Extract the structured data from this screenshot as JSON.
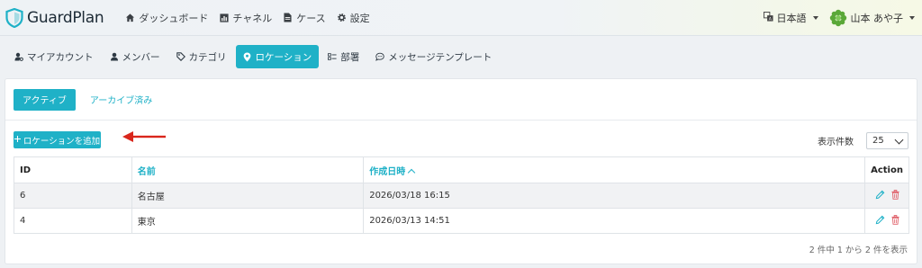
{
  "brand": {
    "name": "GuardPlan"
  },
  "topnav": [
    {
      "label": "ダッシュボード",
      "icon": "home-icon"
    },
    {
      "label": "チャネル",
      "icon": "chart-icon"
    },
    {
      "label": "ケース",
      "icon": "document-icon"
    },
    {
      "label": "設定",
      "icon": "gear-icon"
    }
  ],
  "header": {
    "language": "日本語",
    "user_name": "山本 あや子"
  },
  "tabs": [
    {
      "label": "マイアカウント",
      "icon": "user-gear-icon",
      "active": false
    },
    {
      "label": "メンバー",
      "icon": "person-icon",
      "active": false
    },
    {
      "label": "カテゴリ",
      "icon": "tag-icon",
      "active": false
    },
    {
      "label": "ロケーション",
      "icon": "map-pin-icon",
      "active": true
    },
    {
      "label": "部署",
      "icon": "sliders-icon",
      "active": false
    },
    {
      "label": "メッセージテンプレート",
      "icon": "chat-icon",
      "active": false
    }
  ],
  "subtabs": {
    "active": "アクティブ",
    "archived": "アーカイブ済み"
  },
  "toolbar": {
    "add_label": "ロケーションを追加",
    "per_page_label": "表示件数",
    "per_page_value": "25"
  },
  "table": {
    "columns": [
      "ID",
      "名前",
      "作成日時",
      "Action"
    ],
    "rows": [
      {
        "id": "6",
        "name": "名古屋",
        "created": "2026/03/18 16:15"
      },
      {
        "id": "4",
        "name": "東京",
        "created": "2026/03/13 14:51"
      }
    ]
  },
  "footer": {
    "summary": "2 件中 1 から 2 件を表示"
  },
  "colors": {
    "accent": "#1fb1c7",
    "delete": "#e0626b",
    "arrow": "#d9261c"
  }
}
